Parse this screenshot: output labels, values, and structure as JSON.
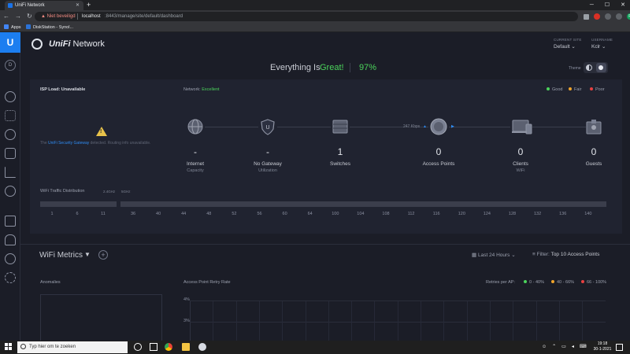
{
  "browser": {
    "tab_title": "UniFi Network",
    "new_tab": "+",
    "security_warning": "Niet beveiligd",
    "url_host": "localhost",
    "url_path": ":8443/manage/site/default/dashboard",
    "bookmarks": [
      "Apps",
      "DiskStation - Synol..."
    ],
    "profile_initial": "R"
  },
  "app": {
    "logo_text": "U",
    "brand_bold": "UniFi",
    "brand_rest": " Network",
    "site_initial": "D",
    "current_site_label": "CURRENT SITE",
    "current_site_value": "Default",
    "username_label": "USERNAME",
    "username_value": "Kclr"
  },
  "status": {
    "title": "Everything Is",
    "great": "Great!",
    "percent": "97%",
    "theme_label": "Theme"
  },
  "topology": {
    "isp_load_label": "ISP Load: ",
    "isp_load_value": "Unavailable",
    "network_label": "Network: ",
    "network_value": "Excellent",
    "legend": [
      {
        "label": "Good",
        "color": "#4bd35b"
      },
      {
        "label": "Fair",
        "color": "#f0a42b"
      },
      {
        "label": "Poor",
        "color": "#e84040"
      }
    ],
    "usg_msg_pre": "The ",
    "usg_msg_link": "UniFi Security Gateway",
    "usg_msg_post": " detected. Routing info unavailable.",
    "throughput": "247 Kbps",
    "devices": [
      {
        "value": "-",
        "label": "Internet",
        "sub": "Capacity"
      },
      {
        "value": "-",
        "label": "No Gateway",
        "sub": "Utilization"
      },
      {
        "value": "1",
        "label": "Switches",
        "sub": ""
      },
      {
        "value": "0",
        "label": "Access Points",
        "sub": ""
      },
      {
        "value": "0",
        "label": "Clients",
        "sub": "WiFi"
      },
      {
        "value": "0",
        "label": "Guests",
        "sub": ""
      }
    ]
  },
  "wifi_traffic": {
    "title": "WiFi Traffic Distribution",
    "band_24": "2.4GHz",
    "band_5": "5GHz",
    "channels_24": [
      "1",
      "6",
      "11"
    ],
    "channels_5": [
      "36",
      "40",
      "44",
      "48",
      "52",
      "56",
      "60",
      "64",
      "100",
      "104",
      "108",
      "112",
      "116",
      "120",
      "124",
      "128",
      "132",
      "136",
      "140"
    ]
  },
  "metrics": {
    "title": "WiFi Metrics",
    "add": "+",
    "time_filter": "Last 24 Hours",
    "filter_label": "Filter: ",
    "filter_value": "Top 10 Access Points",
    "anomalies": "Anomalies",
    "retry_title": "Access Point Retry Rate",
    "retries_label": "Retries per AP:",
    "retry_legend": [
      {
        "label": "0 - 40%",
        "color": "#4bd35b"
      },
      {
        "label": "40 - 66%",
        "color": "#f0a42b"
      },
      {
        "label": "66 - 100%",
        "color": "#e84040"
      }
    ],
    "y_ticks": [
      "4%",
      "3%"
    ]
  },
  "taskbar": {
    "search_placeholder": "Typ hier om te zoeken",
    "time": "19:18",
    "date": "30-1-2021"
  }
}
